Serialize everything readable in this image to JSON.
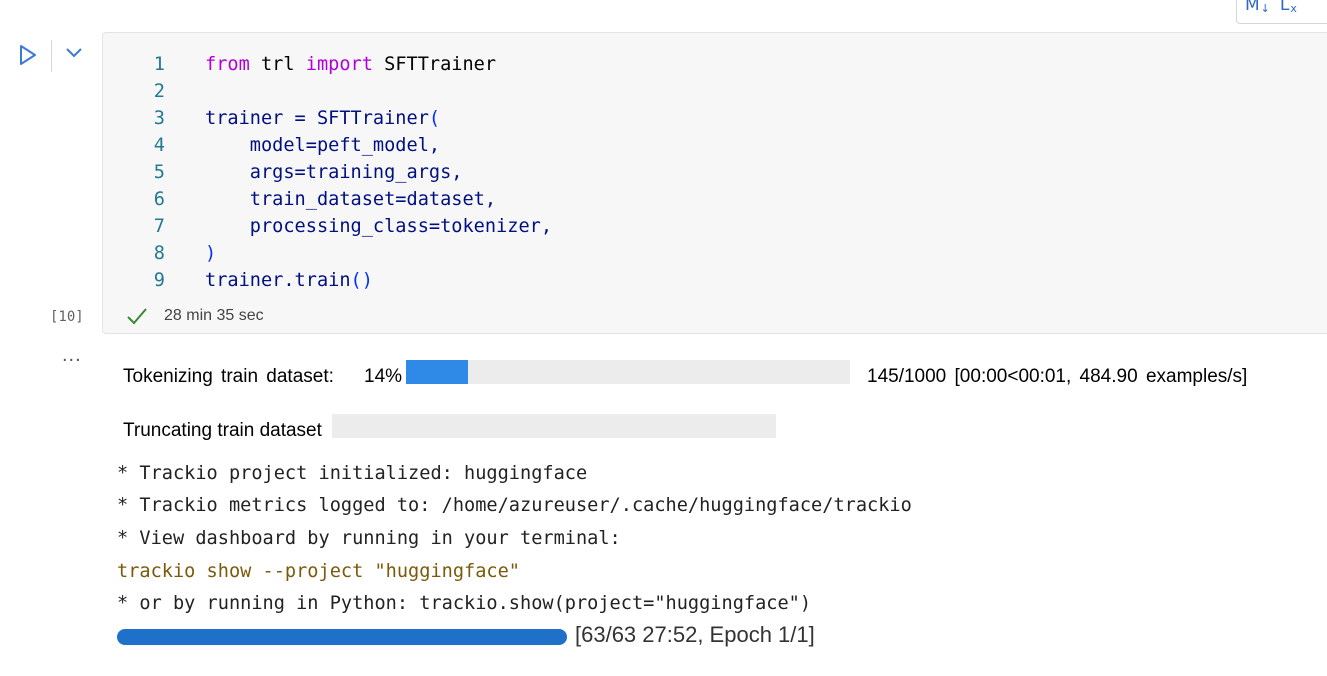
{
  "toolbar": {
    "markdown_label": "M",
    "markdown_arrow": "↓",
    "latex_label": "L",
    "latex_sub": "x"
  },
  "cell": {
    "execution_count": "[10]",
    "duration": "28 min 35 sec",
    "lines": [
      {
        "n": "1"
      },
      {
        "n": "2"
      },
      {
        "n": "3"
      },
      {
        "n": "4"
      },
      {
        "n": "5"
      },
      {
        "n": "6"
      },
      {
        "n": "7"
      },
      {
        "n": "8"
      },
      {
        "n": "9"
      }
    ],
    "tokens": {
      "from": "from",
      "trl": " trl ",
      "import": "import",
      "sfttrainer": " SFTTrainer",
      "trainer_eq": "trainer = SFTTrainer",
      "open_paren": "(",
      "model": "    model=peft_model,",
      "args": "    args=training_args,",
      "train_dataset": "    train_dataset=dataset,",
      "processing_class": "    processing_class=tokenizer,",
      "close_paren": ")",
      "train_call": "trainer.train",
      "call_parens": "()"
    }
  },
  "output": {
    "more": "...",
    "tokenizing": {
      "label": "Tokenizing  train  dataset:",
      "percent": "14%",
      "progress": 0.14,
      "stats": "145/1000  [00:00<00:01,  484.90  examples/s]"
    },
    "truncating": {
      "label": "Truncating train dataset",
      "progress": 0
    },
    "log_lines": [
      "* Trackio project initialized: huggingface",
      "* Trackio metrics logged to: /home/azureuser/.cache/huggingface/trackio",
      "* View dashboard by running in your terminal:",
      "trackio show --project \"huggingface\"",
      "* or by running in Python: trackio.show(project=\"huggingface\")"
    ],
    "training": {
      "progress": 1.0,
      "label": "[63/63 27:52, Epoch 1/1]"
    }
  },
  "colors": {
    "keyword": "#af00db",
    "variable": "#001080",
    "line_number": "#237893",
    "progress_fill": "#2e8ae6",
    "training_fill": "#1e70c8",
    "success": "#388a34"
  }
}
